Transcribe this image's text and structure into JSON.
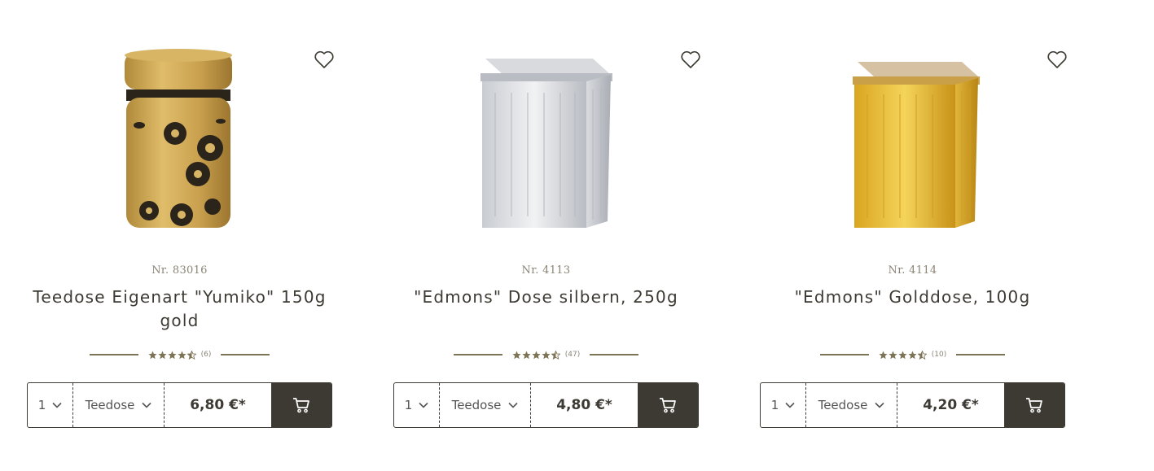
{
  "products": [
    {
      "article_no": "Nr. 83016",
      "title": "Teedose Eigenart \"Yumiko\" 150g gold",
      "rating_count": "(6)",
      "rating": 4.5,
      "quantity": "1",
      "variant": "Teedose",
      "price": "6,80 €*",
      "image": "golden-tea-caddy-with-floral-pattern"
    },
    {
      "article_no": "Nr. 4113",
      "title": "\"Edmons\" Dose silbern, 250g",
      "rating_count": "(47)",
      "rating": 4.5,
      "quantity": "1",
      "variant": "Teedose",
      "price": "4,80 €*",
      "image": "silver-square-tin"
    },
    {
      "article_no": "Nr. 4114",
      "title": "\"Edmons\" Golddose, 100g",
      "rating_count": "(10)",
      "rating": 4.5,
      "quantity": "1",
      "variant": "Teedose",
      "price": "4,20 €*",
      "image": "gold-square-tin"
    }
  ],
  "icons": {
    "wishlist": "heart-outline-icon",
    "cart": "shopping-cart-icon",
    "dropdown": "chevron-down-icon",
    "star": "star-icon"
  },
  "colors": {
    "accent_dark": "#3d3a33",
    "star": "#7d7456",
    "muted_text": "#8a8475"
  }
}
